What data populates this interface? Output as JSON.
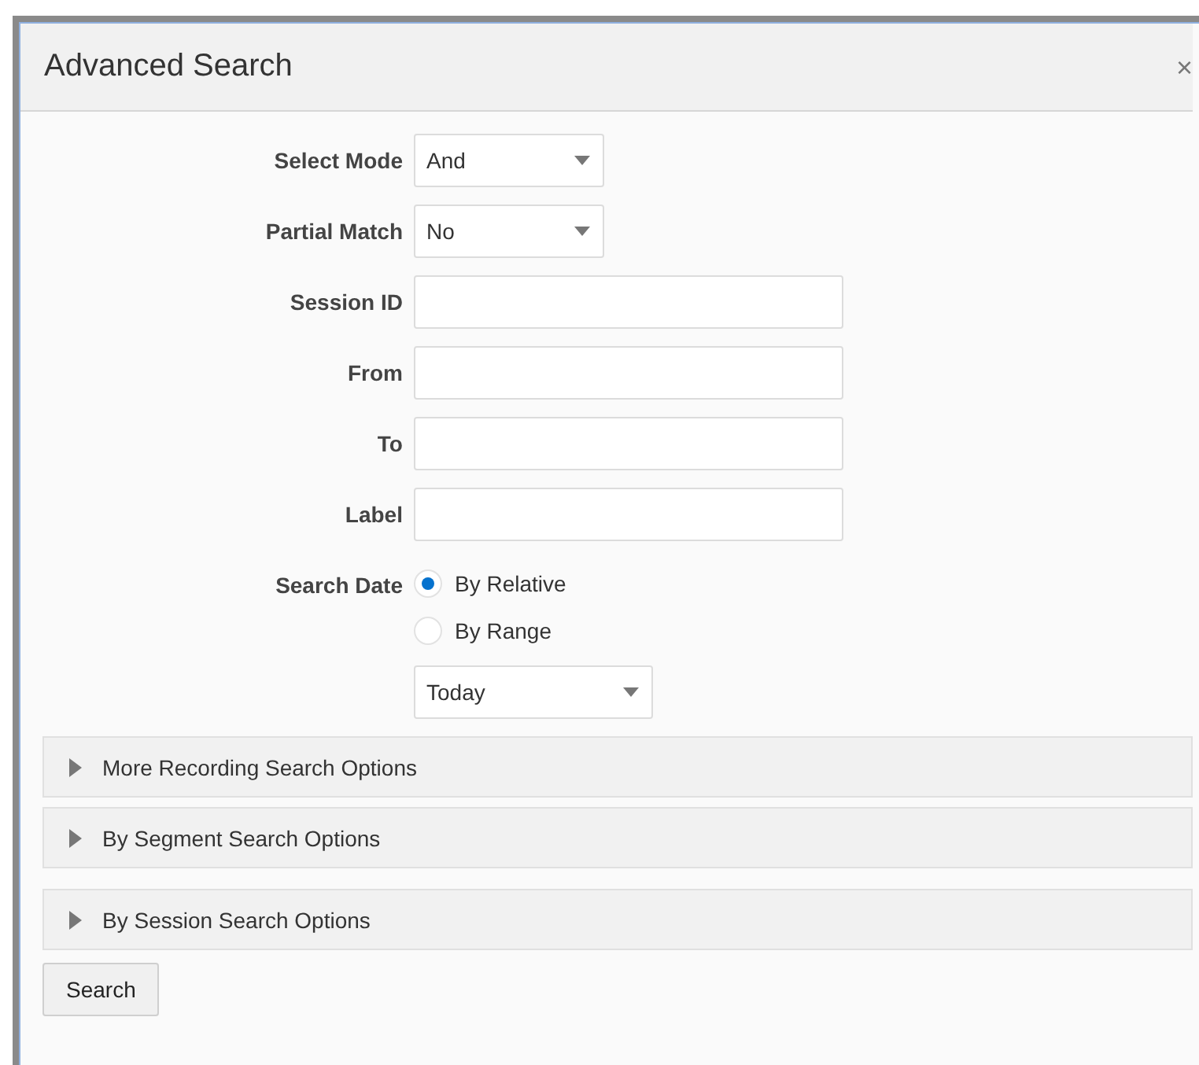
{
  "dialog": {
    "title": "Advanced Search",
    "close": "×"
  },
  "form": [
    {
      "kind": "select",
      "label": "Select Mode",
      "value": "And"
    },
    {
      "kind": "select",
      "label": "Partial Match",
      "value": "No"
    },
    {
      "kind": "text",
      "label": "Session ID"
    },
    {
      "kind": "text",
      "label": "From"
    },
    {
      "kind": "text",
      "label": "To"
    },
    {
      "kind": "text",
      "label": "Label"
    },
    {
      "kind": "radio",
      "label": "Search Date",
      "options": [
        {
          "label": "By Relative",
          "selected": true
        },
        {
          "label": "By Range",
          "selected": false
        }
      ],
      "select_value": "Today"
    }
  ],
  "sections": [
    {
      "label": "More Recording Search Options",
      "expanded": false
    },
    {
      "label": "By Segment Search Options",
      "expanded": false
    },
    {
      "label": "By Session Search Options",
      "expanded": false
    }
  ],
  "buttons": [
    "Search"
  ]
}
